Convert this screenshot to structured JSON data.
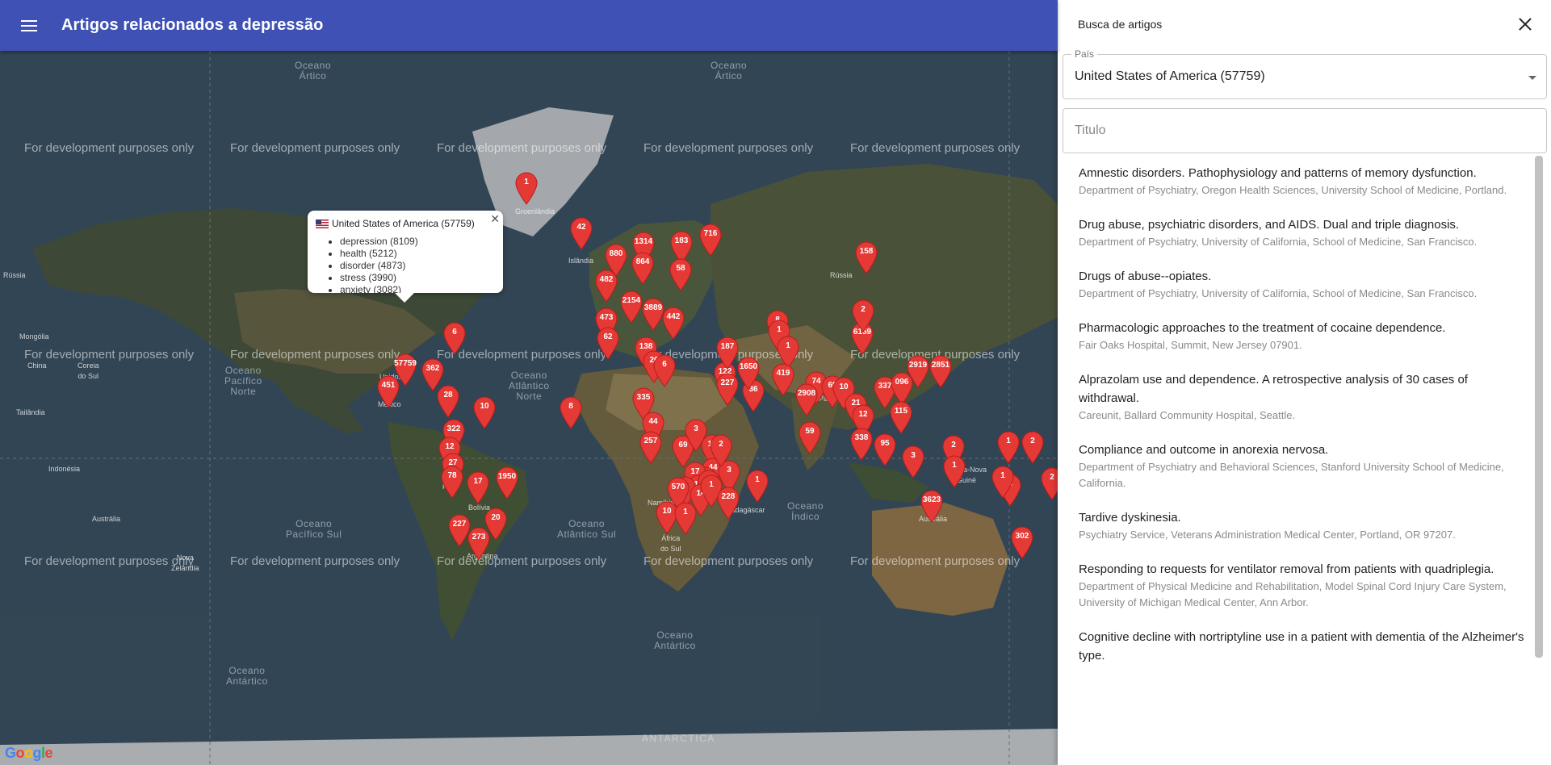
{
  "app": {
    "title": "Artigos relacionados a depressão"
  },
  "map": {
    "watermark": "For development purposes only",
    "labels": {
      "oceano_artico": "Oceano\nÁrtico",
      "oceano_atlantico_norte": "Oceano\nAtlântico\nNorte",
      "oceano_pacifico_norte": "Oceano\nPacífico\nNorte",
      "oceano_pacifico_sul": "Oceano\nPacífico Sul",
      "oceano_atlantico_sul": "Oceano\nAtlântico Sul",
      "oceano_indico": "Oceano\nÍndico",
      "oceano_antartico": "Oceano\nAntártico",
      "antarctica": "ANTARCTICA",
      "russia": "Rússia",
      "russia_west": "Rússia",
      "mongolia": "Mongólia",
      "china": "China",
      "coreia": "Coreia\ndo Sul",
      "tailandia": "Tailândia",
      "indonesia": "Indonésia",
      "australia": "Austrália",
      "groenlandia": "Groenlândia",
      "islandia": "Islândia",
      "mexico": "México",
      "peru": "Peru",
      "bolivia": "Bolívia",
      "argentina": "Argentina",
      "namibia": "Namíbia",
      "africa_sul": "África\ndo Sul",
      "madagascar": "Madagáscar",
      "paquistao": "Paquistão",
      "papua": "Papua-Nova\nGuiné",
      "nova_zelandia": "Nova\nZelândia",
      "unidos": "Unidos"
    },
    "google_logo": "Google"
  },
  "info_window": {
    "country": "United States of America (57759)",
    "terms": [
      "depression (8109)",
      "health (5212)",
      "disorder (4873)",
      "stress (3990)",
      "anxiety (3082)"
    ]
  },
  "panel": {
    "title": "Busca de artigos",
    "country_legend": "País",
    "country_value": "United States of America (57759)",
    "title_placeholder": "Titulo",
    "articles": [
      {
        "title": "Amnestic disorders. Pathophysiology and patterns of memory dysfunction.",
        "affiliation": "Department of Psychiatry, Oregon Health Sciences, University School of Medicine, Portland."
      },
      {
        "title": "Drug abuse, psychiatric disorders, and AIDS. Dual and triple diagnosis.",
        "affiliation": "Department of Psychiatry, University of California, School of Medicine, San Francisco."
      },
      {
        "title": "Drugs of abuse--opiates.",
        "affiliation": "Department of Psychiatry, University of California, School of Medicine, San Francisco."
      },
      {
        "title": "Pharmacologic approaches to the treatment of cocaine dependence.",
        "affiliation": "Fair Oaks Hospital, Summit, New Jersey 07901."
      },
      {
        "title": "Alprazolam use and dependence. A retrospective analysis of 30 cases of withdrawal.",
        "affiliation": "Careunit, Ballard Community Hospital, Seattle."
      },
      {
        "title": "Compliance and outcome in anorexia nervosa.",
        "affiliation": "Department of Psychiatry and Behavioral Sciences, Stanford University School of Medicine, California."
      },
      {
        "title": "Tardive dyskinesia.",
        "affiliation": "Psychiatry Service, Veterans Administration Medical Center, Portland, OR 97207."
      },
      {
        "title": "Responding to requests for ventilator removal from patients with quadriplegia.",
        "affiliation": "Department of Physical Medicine and Rehabilitation, Model Spinal Cord Injury Care System, University of Michigan Medical Center, Ann Arbor."
      },
      {
        "title": "Cognitive decline with nortriptyline use in a patient with dementia of the Alzheimer's type.",
        "affiliation": ""
      }
    ]
  },
  "markers": [
    "1",
    "42",
    "716",
    "183",
    "1314",
    "880",
    "864",
    "58",
    "482",
    "2154",
    "3889",
    "442",
    "473",
    "62",
    "138",
    "26",
    "6",
    "122",
    "227",
    "36",
    "1650",
    "187",
    "8",
    "1",
    "1",
    "419",
    "74",
    "6159",
    "2",
    "2919",
    "2851",
    "2908",
    "69",
    "10",
    "21",
    "12",
    "337",
    "096",
    "115",
    "338",
    "95",
    "59",
    "158",
    "2",
    "1",
    "2",
    "3",
    "3623",
    "1",
    "1",
    "3",
    "2",
    "302",
    "57759",
    "362",
    "451",
    "6",
    "28",
    "10",
    "322",
    "12",
    "27",
    "78",
    "17",
    "1950",
    "227",
    "273",
    "20",
    "8",
    "335",
    "44",
    "257",
    "12",
    "69",
    "44",
    "28",
    "17",
    "15",
    "2",
    "570",
    "2",
    "10",
    "14",
    "1",
    "3",
    "1",
    "228",
    "2",
    "3",
    "1"
  ]
}
